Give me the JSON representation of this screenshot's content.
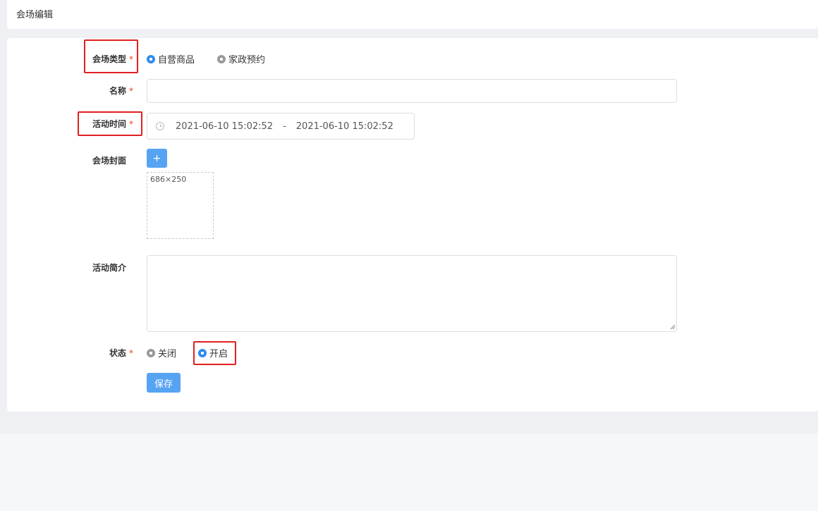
{
  "header": {
    "title": "会场编辑"
  },
  "form": {
    "venue_type": {
      "label": "会场类型",
      "required_mark": "*",
      "options": [
        {
          "label": "自营商品",
          "checked": true
        },
        {
          "label": "家政预约",
          "checked": false
        }
      ]
    },
    "name": {
      "label": "名称",
      "required_mark": "*",
      "value": ""
    },
    "activity_time": {
      "label": "活动时间",
      "required_mark": "*",
      "start": "2021-06-10 15:02:52",
      "separator": "-",
      "end": "2021-06-10 15:02:52"
    },
    "cover": {
      "label": "会场封面",
      "upload_label": "+",
      "size_hint": "686×250"
    },
    "intro": {
      "label": "活动简介",
      "value": ""
    },
    "status": {
      "label": "状态",
      "required_mark": "*",
      "options": [
        {
          "label": "关闭",
          "checked": false
        },
        {
          "label": "开启",
          "checked": true
        }
      ]
    },
    "save_label": "保存"
  },
  "colors": {
    "primary": "#2d8cf0",
    "button": "#57a3f3",
    "required": "#ed4014",
    "highlight": "#e02020"
  }
}
